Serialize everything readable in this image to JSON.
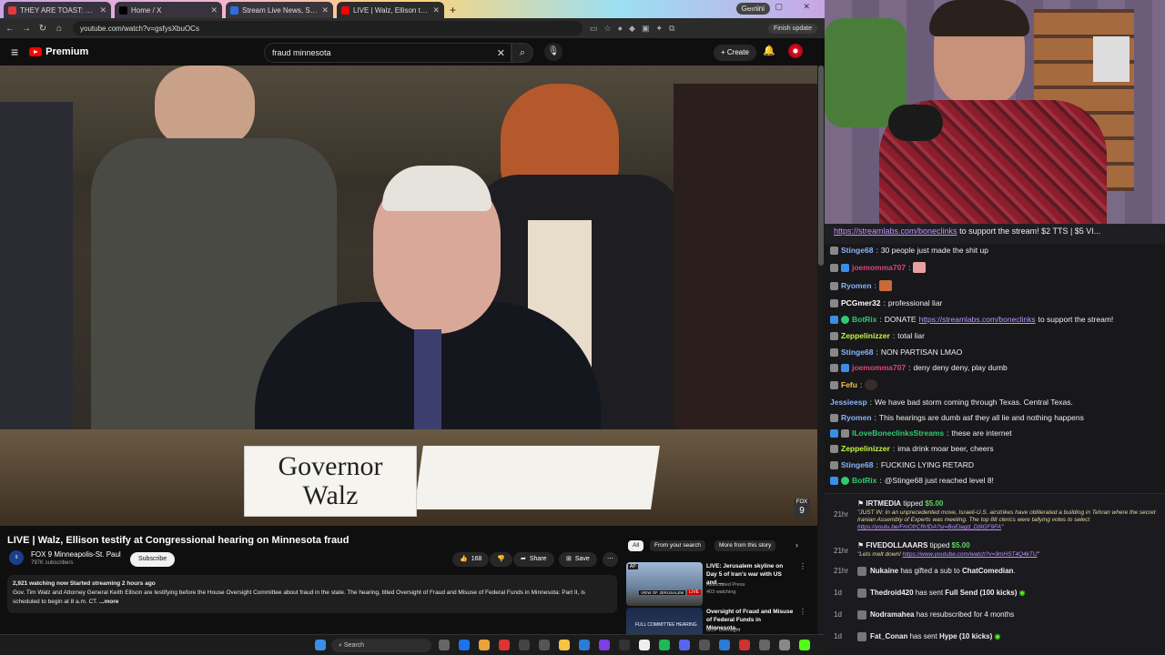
{
  "browser": {
    "tabs": [
      {
        "title": "THEY ARE TOAST: Sec Hegseth",
        "color": "#e03a3a",
        "active": false
      },
      {
        "title": "Home / X",
        "color": "#000000",
        "active": false
      },
      {
        "title": "Stream Live News, Sports",
        "color": "#2a6ee0",
        "active": false
      },
      {
        "title": "LIVE | Walz, Ellison testify at",
        "color": "#ff0000",
        "active": true
      }
    ],
    "gemini_label": "Gemini",
    "url": "youtube.com/watch?v=gsfysXbuOCs",
    "finish_update": "Finish update"
  },
  "youtube": {
    "brand": "Premium",
    "search_query": "fraud minnesota",
    "create_label": "Create",
    "video": {
      "nameplate_line1": "Governor",
      "nameplate_line2": "Walz",
      "badge_line1": "FOX",
      "badge_line2": "9"
    },
    "title": "LIVE | Walz, Ellison testify at Congressional hearing on Minnesota fraud",
    "channel": {
      "logo_line1": "FOX",
      "logo_line2": "9",
      "name": "FOX 9 Minneapolis-St. Paul",
      "subscribers": "797K subscribers",
      "subscribe_label": "Subscribe"
    },
    "actions": {
      "likes": "168",
      "share": "Share",
      "save": "Save"
    },
    "description": {
      "stats": "2,921 watching now  Started streaming 2 hours ago",
      "text": "Gov. Tim Walz and Attorney General Keith Ellison are testifying before the House Oversight Committee about fraud in the state. The hearing, titled Oversight of Fraud and Misuse of Federal Funds in Minnesota: Part II, is scheduled to begin at 8 a.m. CT.",
      "more": "...more"
    },
    "chips": [
      "All",
      "From your search",
      "More from this story"
    ],
    "related": [
      {
        "title": "LIVE: Jerusalem skyline on Day 5 of Iran's war with US and ...",
        "channel": "Associated Press",
        "meta": "403 watching",
        "thumb_text": "VIEW OF JERUSALEM",
        "live": "LIVE",
        "ap": "AP"
      },
      {
        "title": "Oversight of Fraud and Misuse of Federal Funds in Minnesota...",
        "channel": "GOP Oversight",
        "meta": "",
        "thumb_text": "FULL COMMITTEE HEARING",
        "live": "",
        "ap": ""
      }
    ]
  },
  "taskbar": {
    "search": "Search"
  },
  "chat": {
    "pinned": {
      "link": "https://streamlabs.com/boneclinks",
      "text": " to support the stream! $2 TTS | $5 VI..."
    },
    "messages": [
      {
        "user": "Stinge68",
        "color": "#8ab4f8",
        "text": "30 people just made the shit up",
        "badges": []
      },
      {
        "user": "joemomma707",
        "color": "#e0437a",
        "text": "",
        "badges": [
          "#3a8ee6"
        ],
        "emote": true
      },
      {
        "user": "Ryomen",
        "color": "#8ab4f8",
        "text": "",
        "badges": [],
        "emote": true
      },
      {
        "user": "PCGmer32",
        "color": "#ffffff",
        "text": "professional liar",
        "badges": []
      },
      {
        "user": "BotRix",
        "color": "#2ecc71",
        "text": "DONATE ",
        "link": "https://streamlabs.com/boneclinks",
        "after": " to support the stream!",
        "badges": [
          "#3a8ee6",
          "#2ecc71"
        ]
      },
      {
        "user": "Zeppelinizzer",
        "color": "#c6f542",
        "text": "total liar",
        "badges": []
      },
      {
        "user": "Stinge68",
        "color": "#8ab4f8",
        "text": "NON PARTISAN LMAO",
        "badges": []
      },
      {
        "user": "joemomma707",
        "color": "#e0437a",
        "text": "deny deny deny, play dumb",
        "badges": [
          "#3a8ee6"
        ]
      },
      {
        "user": "Fefu",
        "color": "#f5c542",
        "text": "",
        "badges": [],
        "emote": true
      },
      {
        "user": "Jessieesp",
        "color": "#8ab4f8",
        "text": "We have bad storm coming through Texas. Central Texas.",
        "badges": []
      },
      {
        "user": "Ryomen",
        "color": "#8ab4f8",
        "text": "This hearings are dumb asf they all lie and nothing happens",
        "badges": []
      },
      {
        "user": "ILoveBoneclinksStreams",
        "color": "#2ecc71",
        "text": "these are internet",
        "badges": [
          "#3a8ee6"
        ]
      },
      {
        "user": "Zeppelinizzer",
        "color": "#c6f542",
        "text": "ima drink moar beer, cheers",
        "badges": []
      },
      {
        "user": "Stinge68",
        "color": "#8ab4f8",
        "text": "FUCKING LYING RETARD",
        "badges": []
      },
      {
        "user": "BotRix",
        "color": "#2ecc71",
        "text": "@Stinge68 just reached level 8!",
        "badges": [
          "#3a8ee6",
          "#2ecc71"
        ]
      }
    ],
    "events": [
      {
        "time": "21hr",
        "user": "IRTMEDIA",
        "action": " tipped ",
        "amount": "$5.00",
        "quote": "\"JUST IN: In an unprecedented move, Israeli-U.S. airstrikes have obliterated a building in Tehran where the secret Iranian Assembly of Experts was meeting. The top 88 clerics were tallying votes to select ",
        "quote_link": "https://youtu.be/FmOfrCRrfDA?si=BoEtagd_Dj9GF9FA",
        "quote_end": "\""
      },
      {
        "time": "21hr",
        "user": "FIVEDOLLAAARS",
        "action": " tipped ",
        "amount": "$5.00",
        "quote": "\"Lets melt down! ",
        "quote_link": "https://www.youtube.com/watch?v=9mHST4Q4kTU",
        "quote_end": "\""
      },
      {
        "time": "21hr",
        "user": "Nukaine",
        "action": " has gifted a sub to ",
        "target": "ChatComedian",
        "end": "."
      },
      {
        "time": "1d",
        "user": "Thedroid420",
        "action": " has sent ",
        "target": "Full Send (100 kicks)"
      },
      {
        "time": "1d",
        "user": "Nodramahea",
        "action": " has resubscribed for 4 months"
      },
      {
        "time": "1d",
        "user": "Fat_Conan",
        "action": " has sent ",
        "target": "Hype (10 kicks)"
      }
    ]
  }
}
